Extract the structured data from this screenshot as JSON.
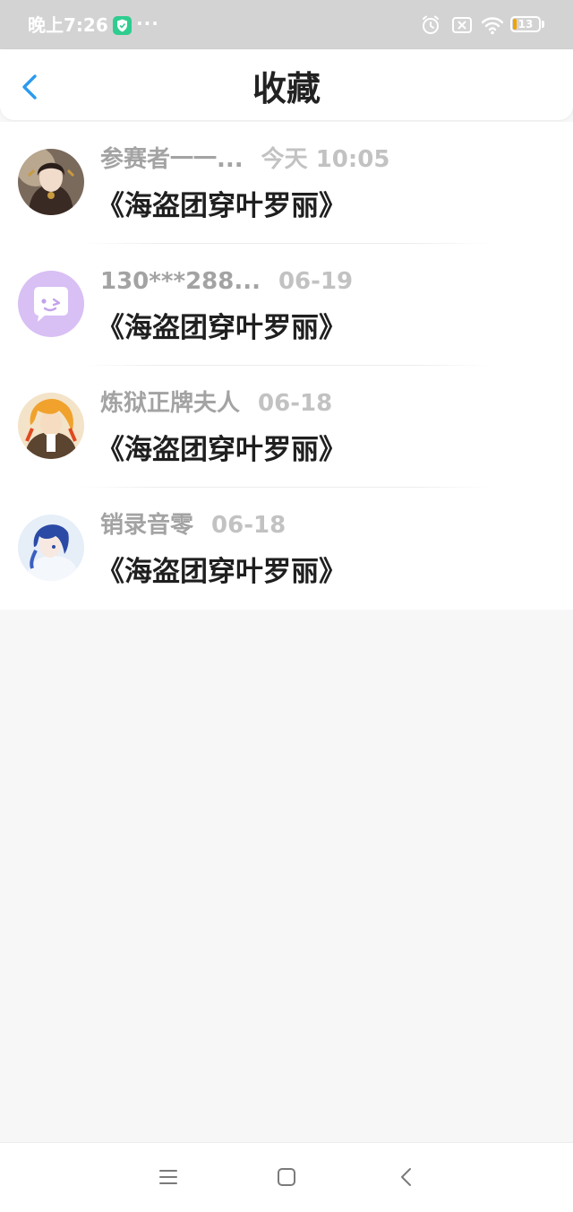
{
  "status_bar": {
    "time": "晚上7:26",
    "dots": "···",
    "battery_level": "13",
    "battery_fraction": 0.13
  },
  "header": {
    "title": "收藏"
  },
  "favorites": [
    {
      "user": "参赛者一一...",
      "time": "今天 10:05",
      "title": "《海盗团穿叶罗丽》"
    },
    {
      "user": "130***288...",
      "time": "06-19",
      "title": "《海盗团穿叶罗丽》"
    },
    {
      "user": "炼狱正牌夫人",
      "time": "06-18",
      "title": "《海盗团穿叶罗丽》"
    },
    {
      "user": "销录音零",
      "time": "06-18",
      "title": "《海盗团穿叶罗丽》"
    }
  ],
  "colors": {
    "accent": "#2b9bef",
    "status_bar_bg": "#d3d3d3",
    "page_bg": "#f8f7f8",
    "username_gray": "#a3a3a3",
    "time_gray": "#c2c2c2"
  }
}
